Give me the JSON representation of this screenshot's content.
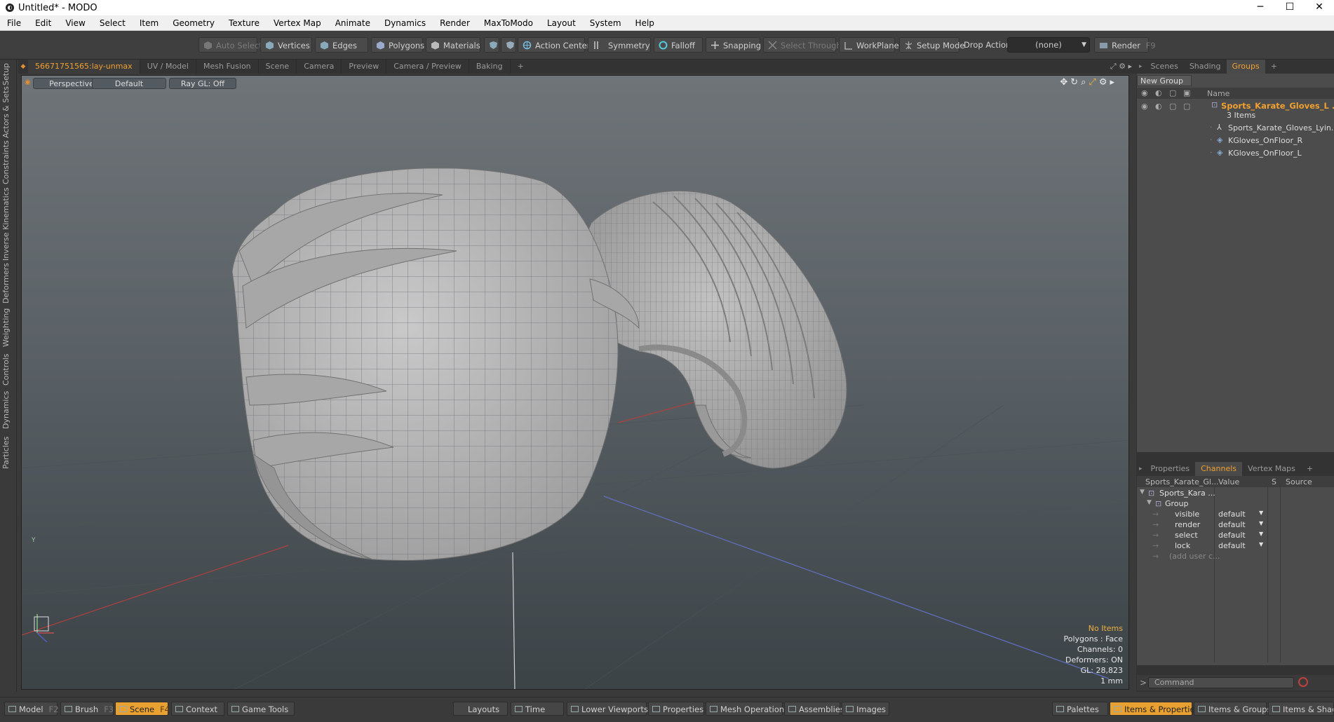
{
  "window": {
    "title": "Untitled* - MODO",
    "min": "─",
    "max": "☐",
    "close": "✕"
  },
  "menu": [
    "File",
    "Edit",
    "View",
    "Select",
    "Item",
    "Geometry",
    "Texture",
    "Vertex Map",
    "Animate",
    "Dynamics",
    "Render",
    "MaxToModo",
    "Layout",
    "System",
    "Help"
  ],
  "toolbar": {
    "auto_select": "Auto Select",
    "vertices": "Vertices",
    "edges": "Edges",
    "polygons": "Polygons",
    "materials": "Materials",
    "action_center": "Action Center",
    "symmetry": "Symmetry",
    "falloff": "Falloff",
    "snapping": "Snapping",
    "select_through": "Select Through",
    "workplane": "WorkPlane",
    "setup_mode": "Setup Mode",
    "drop_action_label": "Drop Action",
    "drop_action_value": "(none)",
    "render": "Render",
    "render_key": "F9"
  },
  "left_tabs": [
    "Setup",
    "Actors & Sets",
    "Constraints",
    "Inverse Kinematics",
    "Deformers",
    "Weighting",
    "Controls",
    "Dynamics",
    "Particles"
  ],
  "viewport_tabs": [
    "56671751565:lay-unmax",
    "UV / Model",
    "Mesh Fusion",
    "Scene",
    "Camera",
    "Preview",
    "Camera / Preview",
    "Baking",
    "+"
  ],
  "viewport": {
    "view": "Perspective",
    "shading": "Default",
    "raygl": "Ray GL: Off",
    "axis_y": "Y",
    "info": {
      "items": "No Items",
      "polygons": "Polygons : Face",
      "channels": "Channels: 0",
      "deformers": "Deformers: ON",
      "gl": "GL: 28,823",
      "unit": "1 mm"
    }
  },
  "scene_panel": {
    "tabs": [
      "Scenes",
      "Shading",
      "Groups",
      "+"
    ],
    "new_group": "New Group",
    "col_name": "Name",
    "root": {
      "name": "Sports_Karate_Gloves_L ...",
      "count": "3 Items"
    },
    "children": [
      "Sports_Karate_Gloves_Lyin...",
      "KGloves_OnFloor_R",
      "KGloves_OnFloor_L"
    ]
  },
  "channels_panel": {
    "tabs": [
      "Properties",
      "Channels",
      "Vertex Maps",
      "+"
    ],
    "col_item": "Sports_Karate_Gl...",
    "col_value": "Value",
    "col_s": "S",
    "col_source": "Source",
    "root": "Sports_Kara ...",
    "group": "Group",
    "rows": [
      {
        "name": "visible",
        "value": "default"
      },
      {
        "name": "render",
        "value": "default"
      },
      {
        "name": "select",
        "value": "default"
      },
      {
        "name": "lock",
        "value": "default"
      }
    ],
    "add_user": "(add user c..."
  },
  "command": {
    "placeholder": "Command",
    "prompt": ">"
  },
  "bottom": {
    "model": "Model",
    "model_key": "F2",
    "brush": "Brush",
    "brush_key": "F3",
    "scene": "Scene",
    "scene_key": "F4",
    "context": "Context",
    "game_tools": "Game Tools",
    "layouts": "Layouts",
    "time": "Time",
    "lower_viewports": "Lower Viewports",
    "properties": "Properties",
    "mesh_operations": "Mesh Operations",
    "assemblies": "Assemblies",
    "images": "Images",
    "palettes": "Palettes",
    "items_properties": "Items & Properties",
    "items_groups": "Items & Groups",
    "items_shading": "Items & Shadin"
  },
  "colors": {
    "accent": "#f0a030",
    "panel": "#3a3a3a",
    "viewport_top": "#6e7478",
    "viewport_bottom": "#3b4347"
  }
}
